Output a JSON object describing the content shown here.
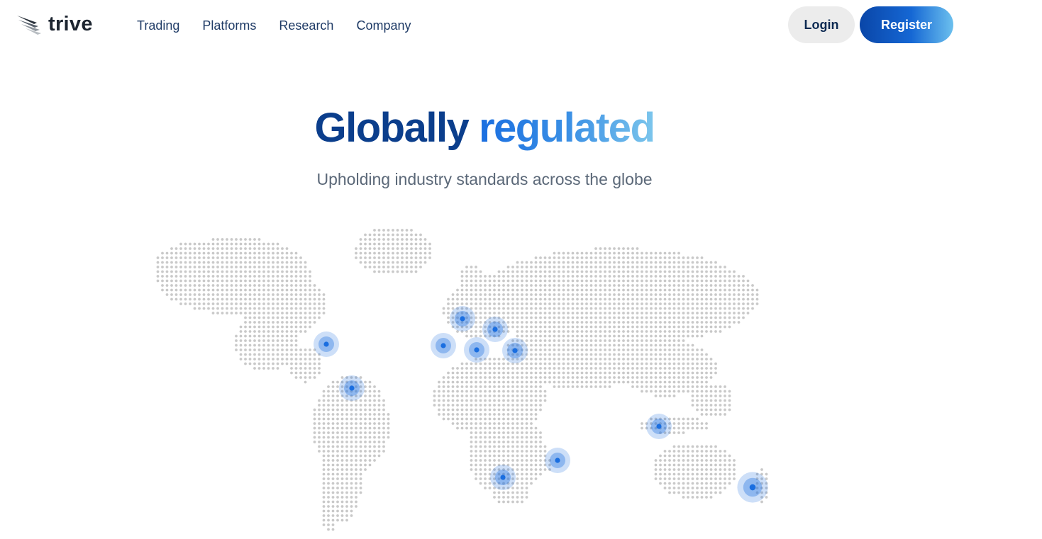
{
  "brand": {
    "name": "trive"
  },
  "nav": {
    "items": [
      {
        "label": "Trading"
      },
      {
        "label": "Platforms"
      },
      {
        "label": "Research"
      },
      {
        "label": "Company"
      }
    ]
  },
  "auth": {
    "login_label": "Login",
    "register_label": "Register"
  },
  "hero": {
    "title_part1": "Globally",
    "title_part2": "regulated",
    "subtitle": "Upholding industry standards across the globe"
  },
  "colors": {
    "brand_dark": "#0b3e8c",
    "accent": "#1a6ee0",
    "accent_light": "#7cc6ec",
    "map_dot": "#c9c9c9",
    "marker": "#1a6ee0"
  },
  "icons": {
    "logo": "wing-logo-icon",
    "marker": "location-marker-icon"
  }
}
